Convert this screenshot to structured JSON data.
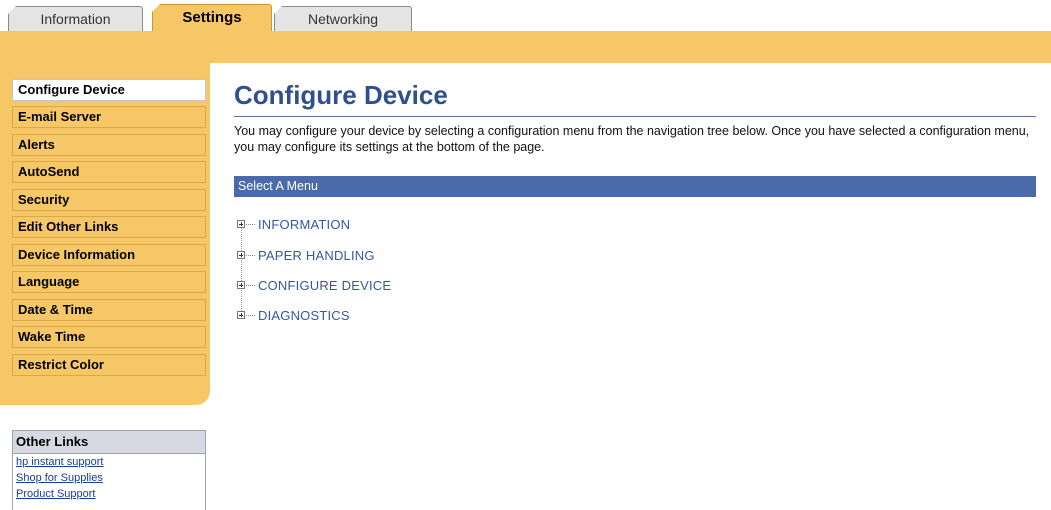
{
  "tabs": {
    "information": "Information",
    "settings": "Settings",
    "networking": "Networking"
  },
  "sidebar": {
    "items": [
      {
        "label": "Configure Device",
        "active": true
      },
      {
        "label": "E-mail Server"
      },
      {
        "label": "Alerts"
      },
      {
        "label": "AutoSend"
      },
      {
        "label": "Security"
      },
      {
        "label": "Edit Other Links"
      },
      {
        "label": "Device Information"
      },
      {
        "label": "Language"
      },
      {
        "label": "Date & Time"
      },
      {
        "label": "Wake Time"
      },
      {
        "label": "Restrict Color"
      }
    ]
  },
  "other_links": {
    "title": "Other Links",
    "links": [
      "hp instant support",
      "Shop for Supplies",
      "Product Support"
    ]
  },
  "main": {
    "title": "Configure Device",
    "intro": "You may configure your device by selecting a configuration menu from the navigation tree below. Once you have selected a configuration menu, you may configure its settings at the bottom of the page.",
    "menu_header": "Select A Menu",
    "tree": [
      "INFORMATION",
      "PAPER HANDLING",
      "CONFIGURE DEVICE",
      "DIAGNOSTICS"
    ]
  },
  "colors": {
    "gold": "#f5c766",
    "title_blue": "#2f4f8f",
    "menu_bar": "#4a6aa9",
    "link": "#1a3aa0"
  },
  "icons": {
    "tree_expander": "plus-box-icon"
  }
}
